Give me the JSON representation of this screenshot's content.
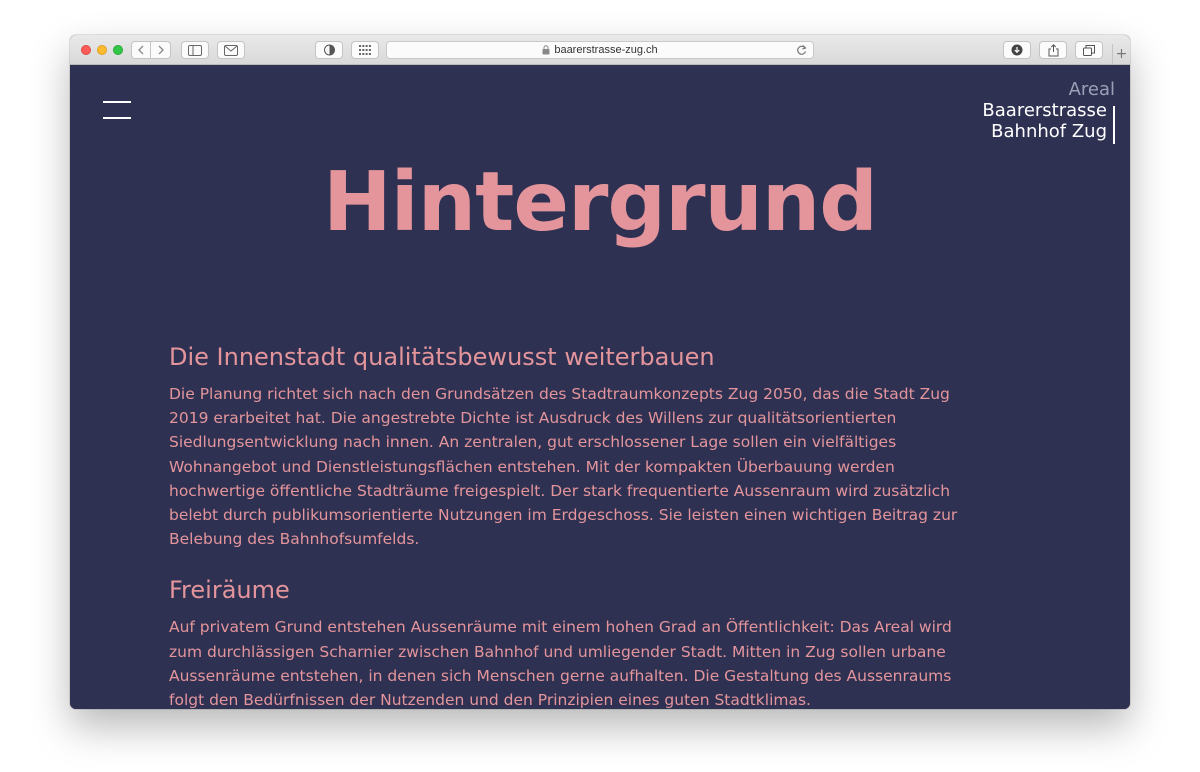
{
  "browser": {
    "url": "baarerstrasse-zug.ch"
  },
  "logo": {
    "line1": "Areal",
    "line2": "Baarerstrasse",
    "line3": "Bahnhof Zug"
  },
  "page": {
    "title": "Hintergrund",
    "sections": [
      {
        "heading": "Die Innenstadt qualitätsbewusst weiterbauen",
        "lines": [
          "Die Planung richtet sich nach den Grundsätzen des Stadtraumkonzepts Zug 2050, das die Stadt Zug",
          "2019 erarbeitet hat. Die angestrebte Dichte ist Ausdruck des Willens zur qualitätsorientierten",
          "Siedlungsentwicklung nach innen. An zentralen, gut erschlossener Lage sollen ein vielfältiges",
          "Wohnangebot und Dienstleistungsflächen entstehen. Mit der kompakten Überbauung werden",
          "hochwertige öffentliche Stadträume freigespielt. Der stark frequentierte Aussenraum wird zusätzlich",
          "belebt durch publikumsorientierte Nutzungen im Erdgeschoss. Sie leisten einen wichtigen Beitrag zur",
          "Belebung des Bahnhofsumfelds."
        ]
      },
      {
        "heading": "Freiräume",
        "lines": [
          "Auf privatem Grund entstehen Aussenräume mit einem hohen Grad an Öffentlichkeit: Das Areal wird",
          "zum durchlässigen Scharnier zwischen Bahnhof und umliegender Stadt. Mitten in Zug sollen urbane",
          "Aussenräume entstehen, in denen sich Menschen gerne aufhalten. Die Gestaltung des Aussenraums",
          "folgt den Bedürfnissen der Nutzenden und den Prinzipien eines guten Stadtklimas."
        ]
      }
    ]
  },
  "colors": {
    "background": "#2f3153",
    "accent": "#e3959b",
    "logo_muted": "#9aa0b6"
  },
  "icons": [
    "back-icon",
    "forward-icon",
    "sidebar-icon",
    "mail-icon",
    "shield-icon",
    "grid-icon",
    "lock-icon",
    "reload-icon",
    "download-icon",
    "share-icon",
    "tabs-icon",
    "plus-icon",
    "menu-icon"
  ]
}
